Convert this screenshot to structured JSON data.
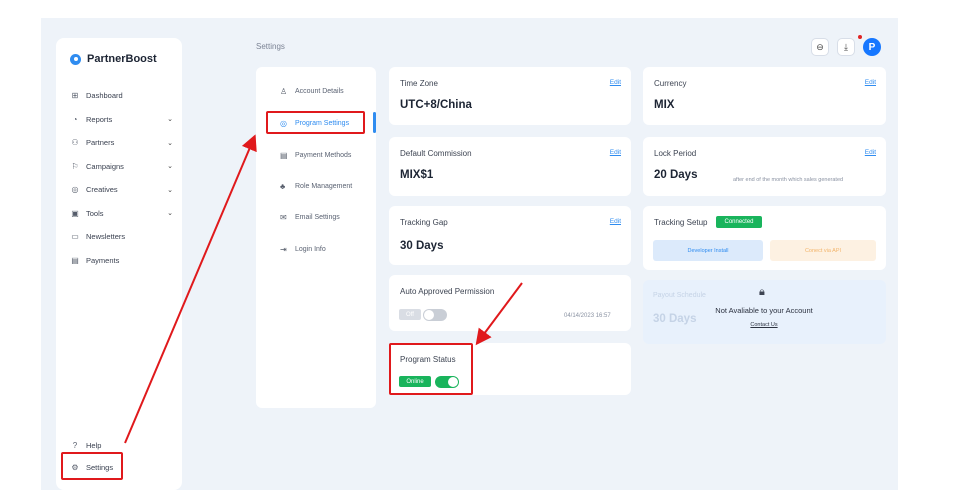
{
  "brand": {
    "name": "PartnerBoost"
  },
  "sidebar": {
    "items": [
      {
        "label": "Dashboard",
        "icon": "dashboard-icon",
        "glyph": "⊞",
        "chevron": ""
      },
      {
        "label": "Reports",
        "icon": "reports-icon",
        "glyph": "◔",
        "chevron": "⌄"
      },
      {
        "label": "Partners",
        "icon": "partners-icon",
        "glyph": "⚇",
        "chevron": "⌄"
      },
      {
        "label": "Campaigns",
        "icon": "campaigns-icon",
        "glyph": "⚐",
        "chevron": "⌄"
      },
      {
        "label": "Creatives",
        "icon": "creatives-icon",
        "glyph": "◎",
        "chevron": "⌄"
      },
      {
        "label": "Tools",
        "icon": "tools-icon",
        "glyph": "▣",
        "chevron": "⌄"
      },
      {
        "label": "Newsletters",
        "icon": "newsletters-icon",
        "glyph": "▭",
        "chevron": ""
      },
      {
        "label": "Payments",
        "icon": "payments-icon",
        "glyph": "▤",
        "chevron": ""
      }
    ],
    "bottom": [
      {
        "label": "Help",
        "icon": "help-icon",
        "glyph": "?"
      },
      {
        "label": "Settings",
        "icon": "settings-icon",
        "glyph": "⚙"
      }
    ]
  },
  "header": {
    "breadcrumb": "Settings",
    "avatar_letter": "P",
    "icons": [
      "minus-circle-icon",
      "download-icon"
    ]
  },
  "settings_menu": {
    "items": [
      {
        "label": "Account Details",
        "glyph": "♙"
      },
      {
        "label": "Program Settings",
        "glyph": "◎"
      },
      {
        "label": "Payment Methods",
        "glyph": "▤"
      },
      {
        "label": "Role Management",
        "glyph": "♣"
      },
      {
        "label": "Email Settings",
        "glyph": "✉"
      },
      {
        "label": "Login Info",
        "glyph": "⇥"
      }
    ]
  },
  "cards": {
    "time_zone": {
      "title": "Time Zone",
      "value": "UTC+8/China",
      "edit": "Edit"
    },
    "currency": {
      "title": "Currency",
      "value": "MIX",
      "edit": "Edit"
    },
    "default_commission": {
      "title": "Default Commission",
      "value": "MIX$1",
      "edit": "Edit"
    },
    "lock_period": {
      "title": "Lock Period",
      "value": "20 Days",
      "edit": "Edit",
      "note": "after end of the month which sales generated"
    },
    "tracking_gap": {
      "title": "Tracking Gap",
      "value": "30 Days",
      "edit": "Edit"
    },
    "tracking_setup": {
      "title": "Tracking Setup",
      "badge": "Connected",
      "developer_button": "Developer Install",
      "api_button": "Conect via API"
    },
    "auto_approved": {
      "title": "Auto Approved Permission",
      "toggle_label": "Off",
      "timestamp": "04/14/2023 16:57"
    },
    "payout_schedule": {
      "title": "Payout Schedule",
      "value": "30 Days",
      "message": "Not Avaliable to your Account",
      "contact": "Contact Us"
    },
    "program_status": {
      "title": "Program Status",
      "toggle_label": "Online"
    }
  },
  "colors": {
    "accent": "#2f8cf0",
    "online_green": "#19b45c",
    "annotation_red": "#e0191c",
    "background": "#eef3f9"
  }
}
